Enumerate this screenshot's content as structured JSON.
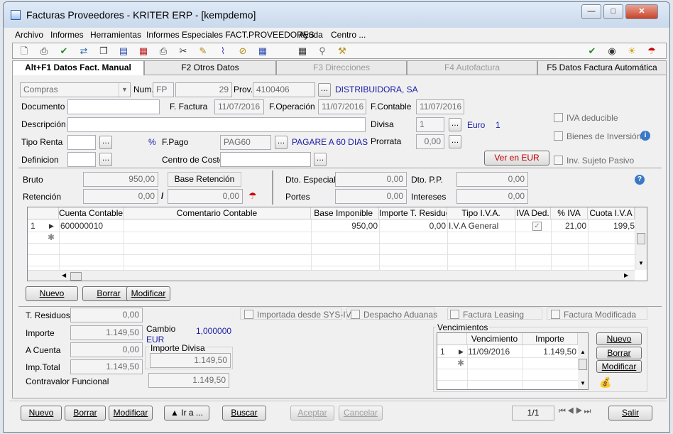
{
  "window": {
    "title": "Facturas Proveedores  - KRITER ERP - [kempdemo]"
  },
  "menu": [
    "Archivo",
    "Informes",
    "Herramientas",
    "Informes Especiales FACT.PROVEEDORES",
    "Ayuda",
    "Centro ..."
  ],
  "tabs": [
    "Alt+F1 Datos Fact. Manual",
    "F2 Otros Datos",
    "F3 Direcciones",
    "F4 Autofactura",
    "F5 Datos Factura Automática"
  ],
  "header": {
    "tipo": "Compras",
    "num_label": "Num.",
    "serie": "FP",
    "numero": "29",
    "prov_label": "Prov.",
    "prov_code": "4100406",
    "prov_name": "DISTRIBUIDORA, SA",
    "documento_label": "Documento",
    "documento": "",
    "f_factura_label": "F. Factura",
    "f_factura": "11/07/2016",
    "f_operacion_label": "F.Operación",
    "f_operacion": "11/07/2016",
    "f_contable_label": "F.Contable",
    "f_contable": "11/07/2016",
    "descripcion_label": "Descripción",
    "descripcion": "",
    "divisa_label": "Divisa",
    "divisa": "1",
    "divisa_name": "Euro",
    "divisa_num": "1",
    "tipo_renta_label": "Tipo Renta",
    "tipo_renta": "",
    "pct": "%",
    "fpago_label": "F.Pago",
    "fpago": "PAG60",
    "fpago_name": "PAGARE A 60 DIAS",
    "prorrata_label": "Prorrata",
    "prorrata": "0,00",
    "definicion_label": "Definicion",
    "definicion": "",
    "centro_coste_label": "Centro de Coste",
    "centro_coste": "",
    "ver_eur": "Ver en EUR",
    "iva_deducible": "IVA deducible",
    "bienes_inversion": "Bienes de Inversión",
    "inv_sujeto_pasivo": "Inv. Sujeto Pasivo"
  },
  "totals": {
    "bruto_label": "Bruto",
    "bruto": "950,00",
    "base_ret_label": "Base Retención",
    "retencion_label": "Retención",
    "retencion": "0,00",
    "ret_slash": "/",
    "base_ret": "0,00",
    "dto_especial_label": "Dto. Especial",
    "dto_especial": "0,00",
    "dto_pp_label": "Dto. P.P.",
    "dto_pp": "0,00",
    "portes_label": "Portes",
    "portes": "0,00",
    "intereses_label": "Intereses",
    "intereses": "0,00"
  },
  "lines": {
    "headers": [
      "Cuenta Contable",
      "Comentario Contable",
      "Base Imponible",
      "Importe T. Residuos",
      "Tipo I.V.A.",
      "IVA Ded.",
      "% IVA",
      "Cuota I.V.A"
    ],
    "rows": [
      {
        "n": "1",
        "cuenta": "600000010",
        "comentario": "",
        "base": "950,00",
        "residuos": "0,00",
        "tipo": "I.V.A General",
        "pct": "21,00",
        "cuota": "199,5"
      }
    ],
    "new_row": "✱"
  },
  "line_buttons": {
    "nuevo": "Nuevo",
    "borrar": "Borrar",
    "modificar": "Modificar"
  },
  "summary": {
    "residuos_label": "T. Residuos",
    "residuos": "0,00",
    "importe_label": "Importe",
    "importe": "1.149,50",
    "a_cuenta_label": "A Cuenta",
    "a_cuenta": "0,00",
    "imp_total_label": "Imp.Total",
    "imp_total": "1.149,50",
    "contravalor_label": "Contravalor Funcional",
    "contravalor": "1.149,50",
    "cambio_label": "Cambio",
    "cambio": "1,000000",
    "cambio_cur": "EUR",
    "importe_divisa_label": "Importe Divisa",
    "importe_divisa": "1.149,50"
  },
  "flags": {
    "importada": "Importada desde SYS-IV",
    "despacho": "Despacho Aduanas",
    "leasing": "Factura Leasing",
    "modificada": "Factura Modificada"
  },
  "vencimientos": {
    "title": "Vencimientos",
    "headers": [
      "Vencimiento",
      "Importe"
    ],
    "rows": [
      {
        "n": "1",
        "fecha": "11/09/2016",
        "importe": "1.149,50"
      }
    ],
    "new_row": "✱",
    "nuevo": "Nuevo",
    "borrar": "Borrar",
    "modificar": "Modificar"
  },
  "footer": {
    "nuevo": "Nuevo",
    "borrar": "Borrar",
    "modificar": "Modificar",
    "ira": "▲ Ir a ...",
    "buscar": "Buscar",
    "aceptar": "Aceptar",
    "cancelar": "Cancelar",
    "pager": "1/1",
    "salir": "Salir"
  }
}
